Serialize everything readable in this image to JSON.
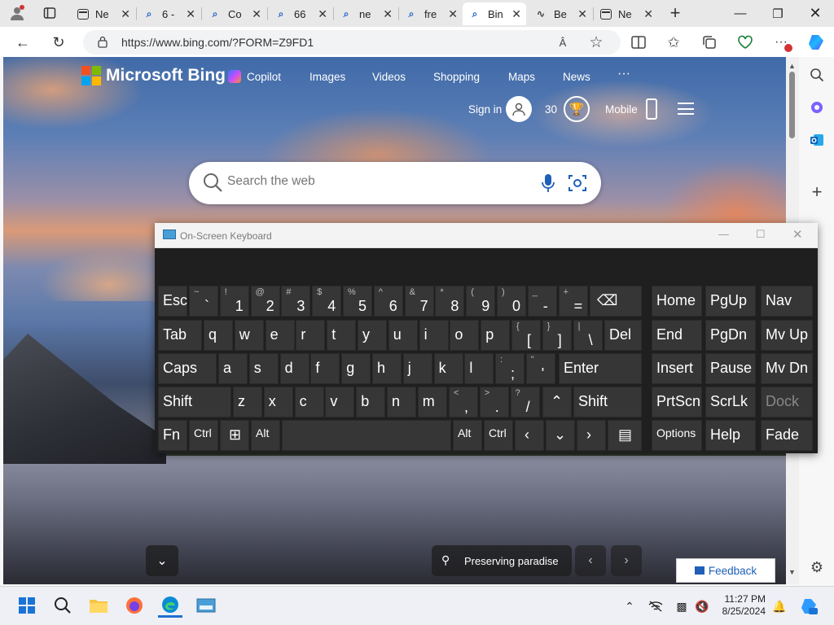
{
  "browser": {
    "tabs": [
      {
        "label": "Ne",
        "icon": "page-icon"
      },
      {
        "label": "6 -",
        "icon": "search-icon"
      },
      {
        "label": "Co",
        "icon": "search-icon"
      },
      {
        "label": "66",
        "icon": "search-icon"
      },
      {
        "label": "ne",
        "icon": "search-icon"
      },
      {
        "label": "fre",
        "icon": "search-icon"
      },
      {
        "label": "Bin",
        "icon": "search-icon",
        "active": true
      },
      {
        "label": "Be",
        "icon": "wave-icon"
      },
      {
        "label": "Ne",
        "icon": "page-icon"
      }
    ],
    "url": "https://www.bing.com/?FORM=Z9FD1",
    "read_aloud": "Â"
  },
  "bing": {
    "logo": "Microsoft Bing",
    "nav": {
      "copilot": "Copilot",
      "images": "Images",
      "videos": "Videos",
      "shopping": "Shopping",
      "maps": "Maps",
      "news": "News",
      "more": "···"
    },
    "sign_in": "Sign in",
    "points": "30",
    "mobile": "Mobile",
    "search_placeholder": "Search the web",
    "location": "Preserving paradise",
    "feedback": "Feedback"
  },
  "osk": {
    "title": "On-Screen Keyboard",
    "keys": {
      "esc": "Esc",
      "tab": "Tab",
      "caps": "Caps",
      "shift": "Shift",
      "fn": "Fn",
      "ctrl": "Ctrl",
      "alt": "Alt",
      "del": "Del",
      "enter": "Enter",
      "home": "Home",
      "pgup": "PgUp",
      "nav": "Nav",
      "end": "End",
      "pgdn": "PgDn",
      "mvup": "Mv Up",
      "insert": "Insert",
      "pause": "Pause",
      "mvdn": "Mv Dn",
      "prtscn": "PrtScn",
      "scrlk": "ScrLk",
      "dock": "Dock",
      "options": "Options",
      "help": "Help",
      "fade": "Fade"
    },
    "number_row": [
      {
        "top": "~",
        "low": "`"
      },
      {
        "top": "!",
        "low": "1"
      },
      {
        "top": "@",
        "low": "2"
      },
      {
        "top": "#",
        "low": "3"
      },
      {
        "top": "$",
        "low": "4"
      },
      {
        "top": "%",
        "low": "5"
      },
      {
        "top": "^",
        "low": "6"
      },
      {
        "top": "&",
        "low": "7"
      },
      {
        "top": "*",
        "low": "8"
      },
      {
        "top": "(",
        "low": "9"
      },
      {
        "top": ")",
        "low": "0"
      },
      {
        "top": "_",
        "low": "-"
      },
      {
        "top": "+",
        "low": "="
      }
    ],
    "row_q": [
      "q",
      "w",
      "e",
      "r",
      "t",
      "y",
      "u",
      "i",
      "o",
      "p"
    ],
    "row_q_sym": [
      {
        "top": "{",
        "low": "["
      },
      {
        "top": "}",
        "low": "]"
      },
      {
        "top": "|",
        "low": "\\"
      }
    ],
    "row_a": [
      "a",
      "s",
      "d",
      "f",
      "g",
      "h",
      "j",
      "k",
      "l"
    ],
    "row_a_sym": [
      {
        "top": ":",
        "low": ";"
      },
      {
        "top": "\"",
        "low": "'"
      }
    ],
    "row_z": [
      "z",
      "x",
      "c",
      "v",
      "b",
      "n",
      "m"
    ],
    "row_z_sym": [
      {
        "top": "<",
        "low": ","
      },
      {
        "top": ">",
        "low": "."
      },
      {
        "top": "?",
        "low": "/"
      }
    ]
  },
  "taskbar": {
    "time": "11:27 PM",
    "date": "8/25/2024"
  },
  "colors": {
    "ms_red": "#f25022",
    "ms_green": "#7fba00",
    "ms_blue": "#00a4ef",
    "ms_yellow": "#ffb900",
    "keyboard_bg": "#1f1f1f",
    "key_bg": "#363636",
    "feedback_text": "#1f5fb7"
  }
}
